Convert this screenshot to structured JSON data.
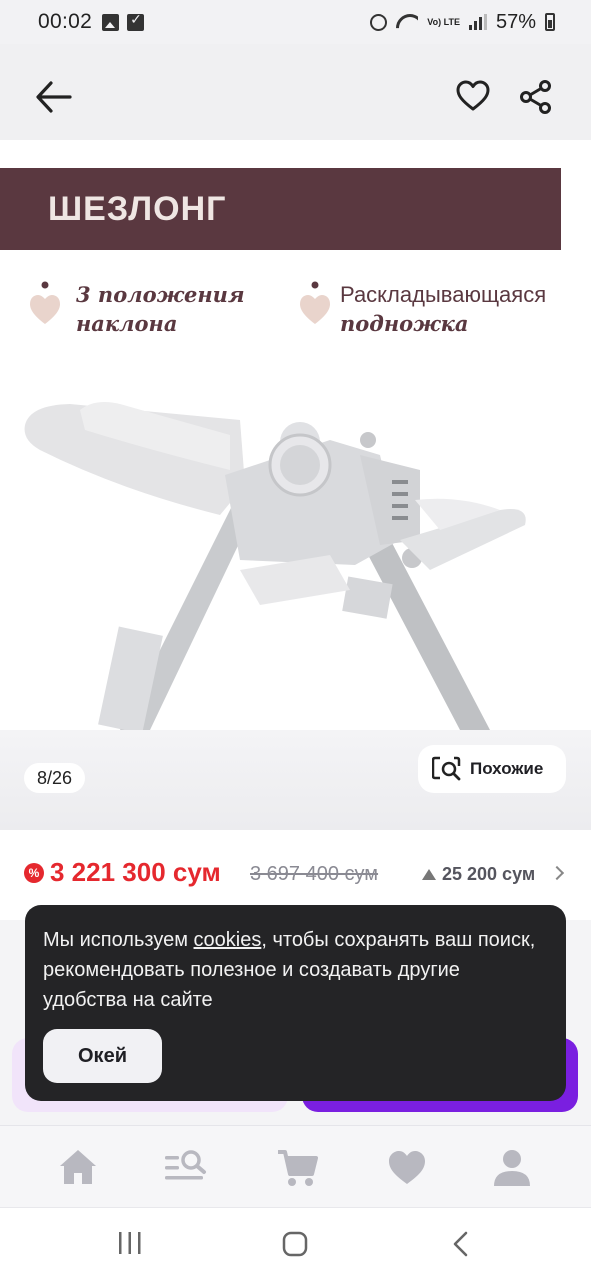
{
  "status_bar": {
    "time": "00:02",
    "battery": "57%",
    "network": "Vo) LTE"
  },
  "header": {
    "back_icon": "arrow-left-icon",
    "favorite_icon": "heart-icon",
    "share_icon": "share-icon"
  },
  "gallery": {
    "banner_title": "ШЕЗЛОНГ",
    "features": [
      {
        "line1": "3 положения",
        "line2": "наклона"
      },
      {
        "line1": "Раскладывающаяся",
        "line2": "подножка"
      }
    ],
    "counter": "8/26",
    "similar_label": "Похожие"
  },
  "price": {
    "current": "3 221 300 сум",
    "old": "3 697 400 сум",
    "delta": "25 200 сум"
  },
  "cookie": {
    "text_before": "Мы используем ",
    "link": "cookies",
    "text_after": ", чтобы сохранять ваш поиск, рекомендовать полезное и создавать другие удобства на сайте",
    "ok_label": "Окей"
  },
  "bottom_nav": {
    "items": [
      "home-icon",
      "catalog-search-icon",
      "cart-icon",
      "favorites-heart-icon",
      "profile-icon"
    ]
  },
  "colors": {
    "banner": "#5a3840",
    "price": "#e5282e",
    "accent": "#7a1fe0"
  }
}
